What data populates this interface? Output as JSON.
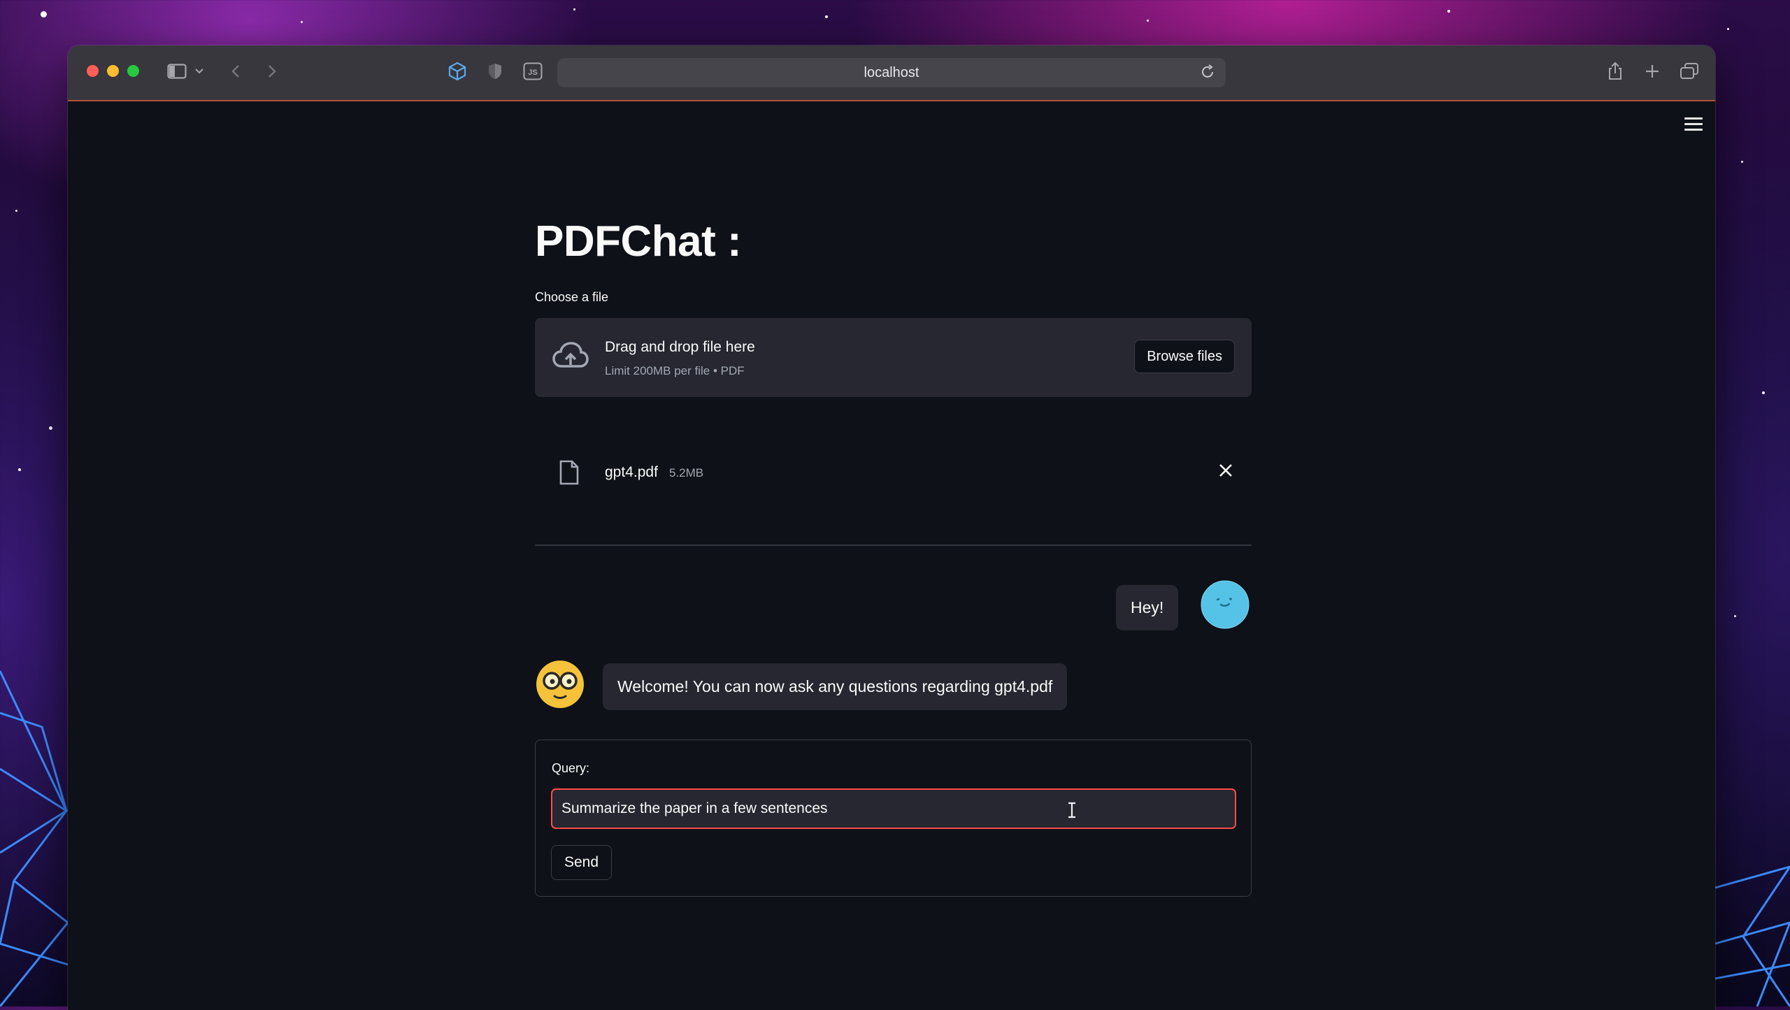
{
  "browser": {
    "url": "localhost",
    "toolbar_icons": [
      "sidebar-icon",
      "chevron-down-icon",
      "back-icon",
      "forward-icon",
      "cube-extension-icon",
      "shield-extension-icon",
      "js-extension-icon",
      "reload-icon",
      "share-icon",
      "new-tab-icon",
      "tab-overview-icon"
    ]
  },
  "app": {
    "title": "PDFChat :",
    "menu_icon": "hamburger-menu-icon",
    "uploader": {
      "label": "Choose a file",
      "drop_text": "Drag and drop file here",
      "limit_text": "Limit 200MB per file • PDF",
      "browse_button": "Browse files",
      "file": {
        "name": "gpt4.pdf",
        "size": "5.2MB"
      }
    },
    "chat": {
      "messages": [
        {
          "role": "user",
          "text": "Hey!"
        },
        {
          "role": "bot",
          "text": "Welcome! You can now ask any questions regarding gpt4.pdf"
        }
      ]
    },
    "form": {
      "query_label": "Query:",
      "query_value": "Summarize the paper in a few sentences",
      "send_button": "Send"
    }
  },
  "colors": {
    "app_background": "#0e1117",
    "panel": "#262730",
    "accent_focus": "#ff4b4b",
    "user_avatar": "#55c3e8",
    "bot_avatar": "#f5c23a"
  }
}
